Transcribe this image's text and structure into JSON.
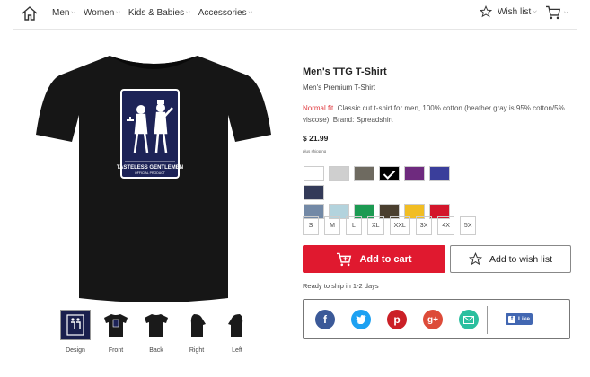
{
  "nav": {
    "menu": [
      {
        "label": "Men"
      },
      {
        "label": "Women"
      },
      {
        "label": "Kids & Babies"
      },
      {
        "label": "Accessories"
      }
    ],
    "wishlist_label": "Wish list"
  },
  "product": {
    "title": "Men's TTG T-Shirt",
    "subtitle": "Men's Premium T-Shirt",
    "fit_label": "Normal fit.",
    "description": " Classic cut t-shirt for men, 100% cotton (heather gray is 95% cotton/5% viscose). Brand: Spreadshirt",
    "price": "$ 21.99",
    "shipping_note": "plus shipping",
    "logo_text": "TASTELESS GENTLEMEN",
    "logo_subtext": "OFFICIAL PRODUCT"
  },
  "thumbnails": [
    {
      "label": "Design"
    },
    {
      "label": "Front"
    },
    {
      "label": "Back"
    },
    {
      "label": "Right"
    },
    {
      "label": "Left"
    }
  ],
  "colors": {
    "swatches": [
      "#ffffff",
      "#cfcfcf",
      "#6e6a60",
      "#000000",
      "#6e2a7e",
      "#3a3e9b",
      "#333a58",
      "#7389a6",
      "#b3d3dd",
      "#1c9a52",
      "#4a3f2f",
      "#f1bd23",
      "#d3162b"
    ],
    "selected_index": 3,
    "accent": "#e0192f"
  },
  "sizes": [
    "S",
    "M",
    "L",
    "XL",
    "XXL",
    "3X",
    "4X",
    "5X"
  ],
  "actions": {
    "add_to_cart": "Add to cart",
    "add_to_wishlist": "Add to wish list",
    "ready_to_ship": "Ready to ship in 1-2 days"
  },
  "share": {
    "icons": [
      "facebook-icon",
      "twitter-icon",
      "pinterest-icon",
      "google-plus-icon",
      "email-icon"
    ],
    "like_label": "Like"
  }
}
